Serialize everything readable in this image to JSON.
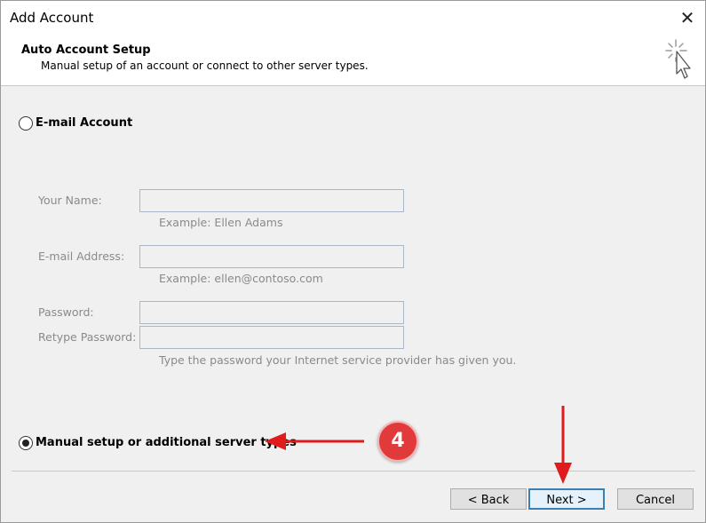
{
  "window": {
    "title": "Add Account",
    "close_glyph": "✕"
  },
  "header": {
    "title": "Auto Account Setup",
    "subtitle": "Manual setup of an account or connect to other server types."
  },
  "email_option": {
    "label": "E-mail Account",
    "selected": false
  },
  "fields": {
    "your_name": {
      "label": "Your Name:",
      "value": "",
      "hint": "Example: Ellen Adams"
    },
    "email_address": {
      "label": "E-mail Address:",
      "value": "",
      "hint": "Example: ellen@contoso.com"
    },
    "password": {
      "label": "Password:",
      "value": ""
    },
    "retype_password": {
      "label": "Retype Password:",
      "value": ""
    },
    "password_hint": "Type the password your Internet service provider has given you."
  },
  "manual_option": {
    "label": "Manual setup or additional server types",
    "selected": true
  },
  "annotation": {
    "step_number": "4",
    "color": "#e03a3a"
  },
  "buttons": {
    "back": "< Back",
    "next": "Next >",
    "cancel": "Cancel"
  },
  "colors": {
    "accent": "#3c7fb1",
    "annotation_red": "#e01b1b"
  }
}
